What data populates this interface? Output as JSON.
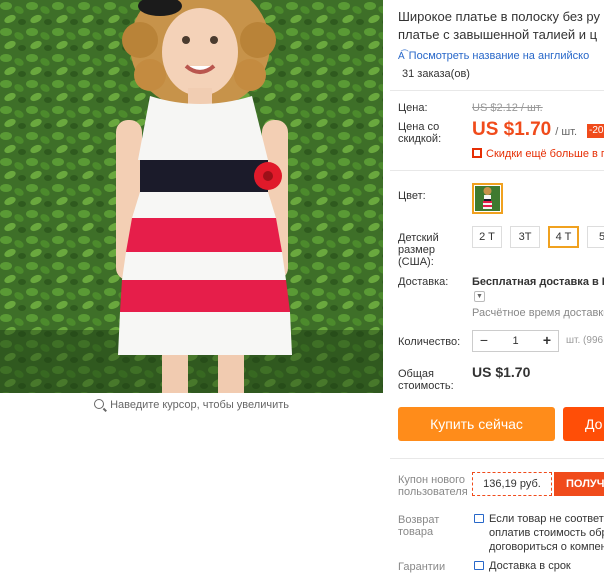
{
  "product": {
    "image_hint": "Наведите курсор, чтобы увеличить",
    "title_lines": [
      "Широкое платье в полоску без ру",
      "платье с завышенной талией и ц"
    ],
    "translate_link": "Посмотреть название на английско",
    "orders": "31 заказа(ов)"
  },
  "price": {
    "label": "Цена:",
    "old": "US $2.12 / шт.",
    "discount_label": "Цена со скидкой:",
    "new": "US $1.70",
    "unit": "/ шт.",
    "discount_badge": "-20",
    "promo": "Скидки ещё больше в п"
  },
  "options": {
    "color_label": "Цвет:",
    "size_label": "Детский размер (США):",
    "sizes": [
      {
        "label": "2 T",
        "selected": false
      },
      {
        "label": "3T",
        "selected": false
      },
      {
        "label": "4 T",
        "selected": true
      },
      {
        "label": "5",
        "selected": false
      }
    ]
  },
  "shipping": {
    "label": "Доставка:",
    "method": "Бесплатная доставка в R",
    "time": "Расчётное время доставки"
  },
  "quantity": {
    "label": "Количество:",
    "value": "1",
    "minus": "−",
    "plus": "+",
    "unit": "шт. (996"
  },
  "total": {
    "label": "Общая стоимость:",
    "value": "US $1.70"
  },
  "actions": {
    "buy_now": "Купить сейчас",
    "add_to_cart": "До"
  },
  "coupon": {
    "label": "Купон нового пользователя",
    "amount": "136,19 руб.",
    "button": "ПОЛУЧ"
  },
  "returns": {
    "label": "Возврат товара",
    "lines": [
      "Если товар не соответс",
      "оплатив стоимость обр",
      "договориться о компен"
    ]
  },
  "guarantee": {
    "label": "Гарантии",
    "text": "Доставка в срок"
  },
  "colors": {
    "accent_orange": "#ff8c1a",
    "accent_red": "#f04b1b",
    "selected_border": "#f0a11f",
    "link_blue": "#2767c9"
  }
}
